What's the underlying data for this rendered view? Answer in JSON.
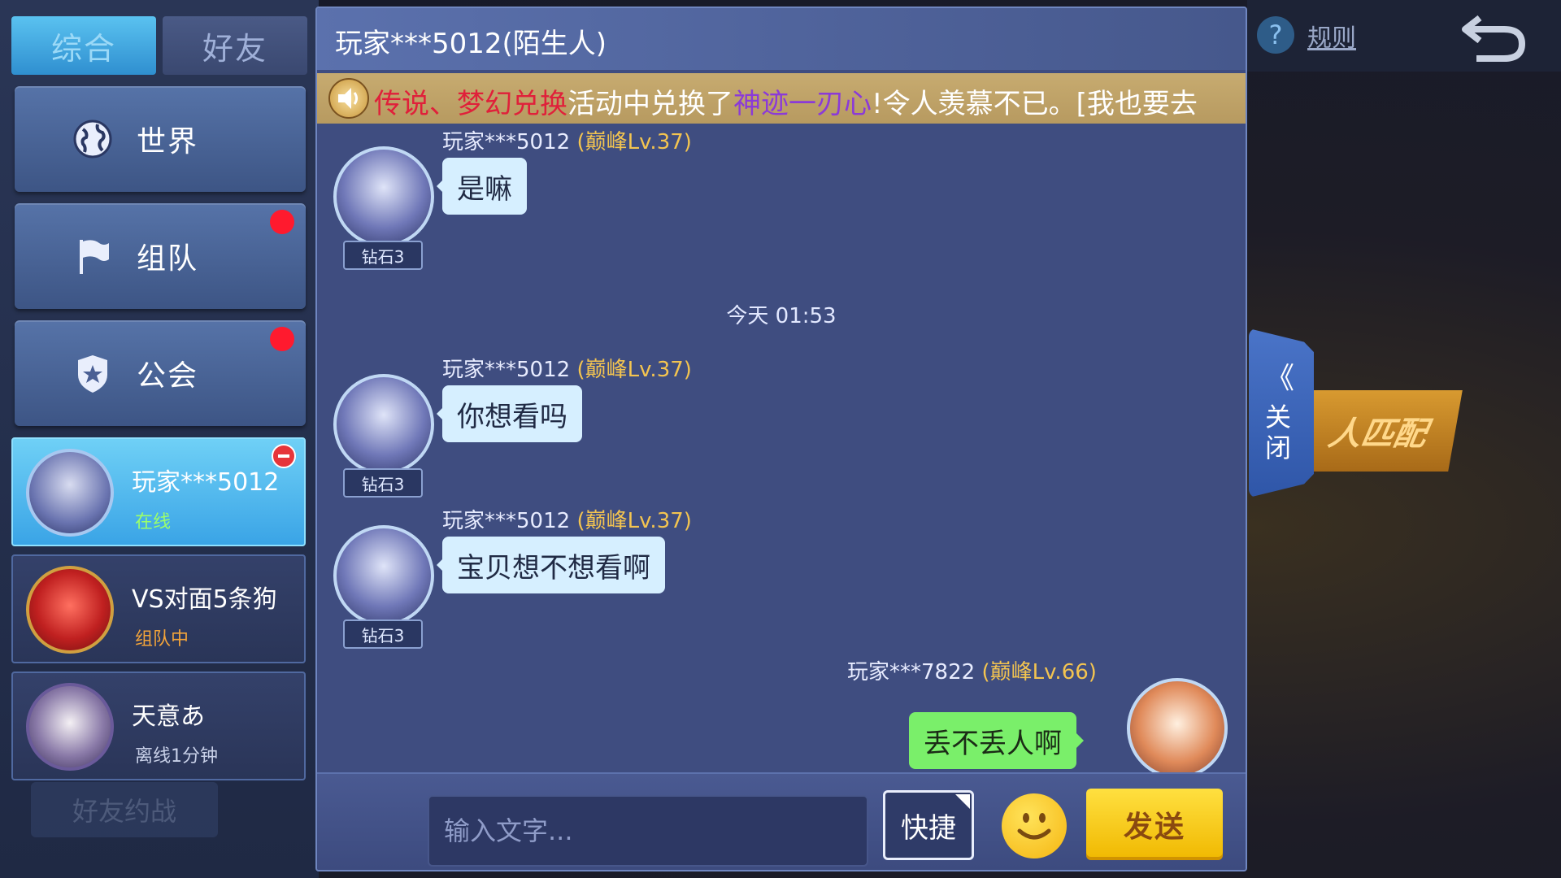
{
  "tabs": [
    {
      "label": "综合",
      "active": true
    },
    {
      "label": "好友",
      "active": false
    }
  ],
  "categories": [
    {
      "label": "世界",
      "icon": "globe-icon",
      "badge": false
    },
    {
      "label": "组队",
      "icon": "flag-icon",
      "badge": true
    },
    {
      "label": "公会",
      "icon": "shield-star-icon",
      "badge": true
    }
  ],
  "friends": [
    {
      "name": "玩家***5012",
      "status": "在线",
      "active": true
    },
    {
      "name": "VS对面5条狗",
      "status": "组队中",
      "active": false
    },
    {
      "name": "天意あ",
      "status": "离线1分钟",
      "active": false
    }
  ],
  "invite_button": "好友约战",
  "chat": {
    "title": "玩家***5012(陌生人)",
    "notice": {
      "part1": "传说、梦幻兑换",
      "part2": "活动中兑换了",
      "part3": "神迹一刃心",
      "part4": "!令人羡慕不已。[我也要去"
    },
    "messages": [
      {
        "sender": "玩家***5012",
        "level": "(巅峰Lv.37)",
        "rank": "钻石3",
        "text": "是嘛"
      },
      {
        "sender": "玩家***5012",
        "level": "(巅峰Lv.37)",
        "rank": "钻石3",
        "text": "你想看吗"
      },
      {
        "sender": "玩家***5012",
        "level": "(巅峰Lv.37)",
        "rank": "钻石3",
        "text": "宝贝想不想看啊"
      },
      {
        "sender": "玩家***7822",
        "level": "(巅峰Lv.66)",
        "text": "丢不丢人啊"
      }
    ],
    "timestamp": "今天 01:53",
    "input_placeholder": "输入文字...",
    "quick_label": "快捷",
    "send_label": "发送"
  },
  "top_right": {
    "rules_label": "规则"
  },
  "side_panel": {
    "chevron": "《",
    "close_label": "关闭",
    "match_label": "人匹配"
  },
  "colors": {
    "accent_blue": "#3aa4e6",
    "online_status": "#9cff6a",
    "team_status": "#f3a43a",
    "offline_status": "#c8d0e8",
    "level_gold": "#f3c450",
    "self_bubble": "#7aef6a",
    "other_bubble": "#d6efff",
    "send_button": "#f0b800",
    "badge_red": "#ff1a2e"
  }
}
